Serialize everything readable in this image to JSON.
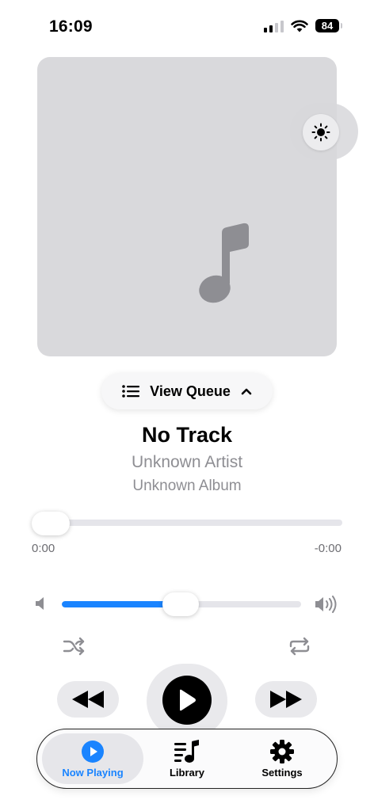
{
  "status_bar": {
    "time": "16:09",
    "battery": "84",
    "icons": [
      "cellular-signal-icon",
      "wifi-icon",
      "battery-icon"
    ]
  },
  "artwork": {
    "placeholder_icon": "music-note-icon",
    "theme_toggle_icon": "sun-icon"
  },
  "queue": {
    "label": "View Queue",
    "icon": "list-icon",
    "chevron": "chevron-up-icon"
  },
  "track": {
    "title": "No Track",
    "artist": "Unknown Artist",
    "album": "Unknown Album"
  },
  "progress": {
    "elapsed": "0:00",
    "remaining": "-0:00",
    "fraction": 0
  },
  "volume": {
    "level": 0.55,
    "low_icon": "speaker-low-icon",
    "high_icon": "speaker-high-icon"
  },
  "controls": {
    "shuffle_icon": "shuffle-icon",
    "repeat_icon": "repeat-icon",
    "rewind_icon": "rewind-icon",
    "play_icon": "play-icon",
    "forward_icon": "fast-forward-icon"
  },
  "tabs": [
    {
      "label": "Now Playing",
      "icon": "play-circle-icon",
      "active": true
    },
    {
      "label": "Library",
      "icon": "music-list-icon",
      "active": false
    },
    {
      "label": "Settings",
      "icon": "gear-icon",
      "active": false
    }
  ],
  "colors": {
    "accent": "#1a84ff",
    "secondary_text": "#8e8e93",
    "artwork_bg": "#d9d9dc"
  }
}
